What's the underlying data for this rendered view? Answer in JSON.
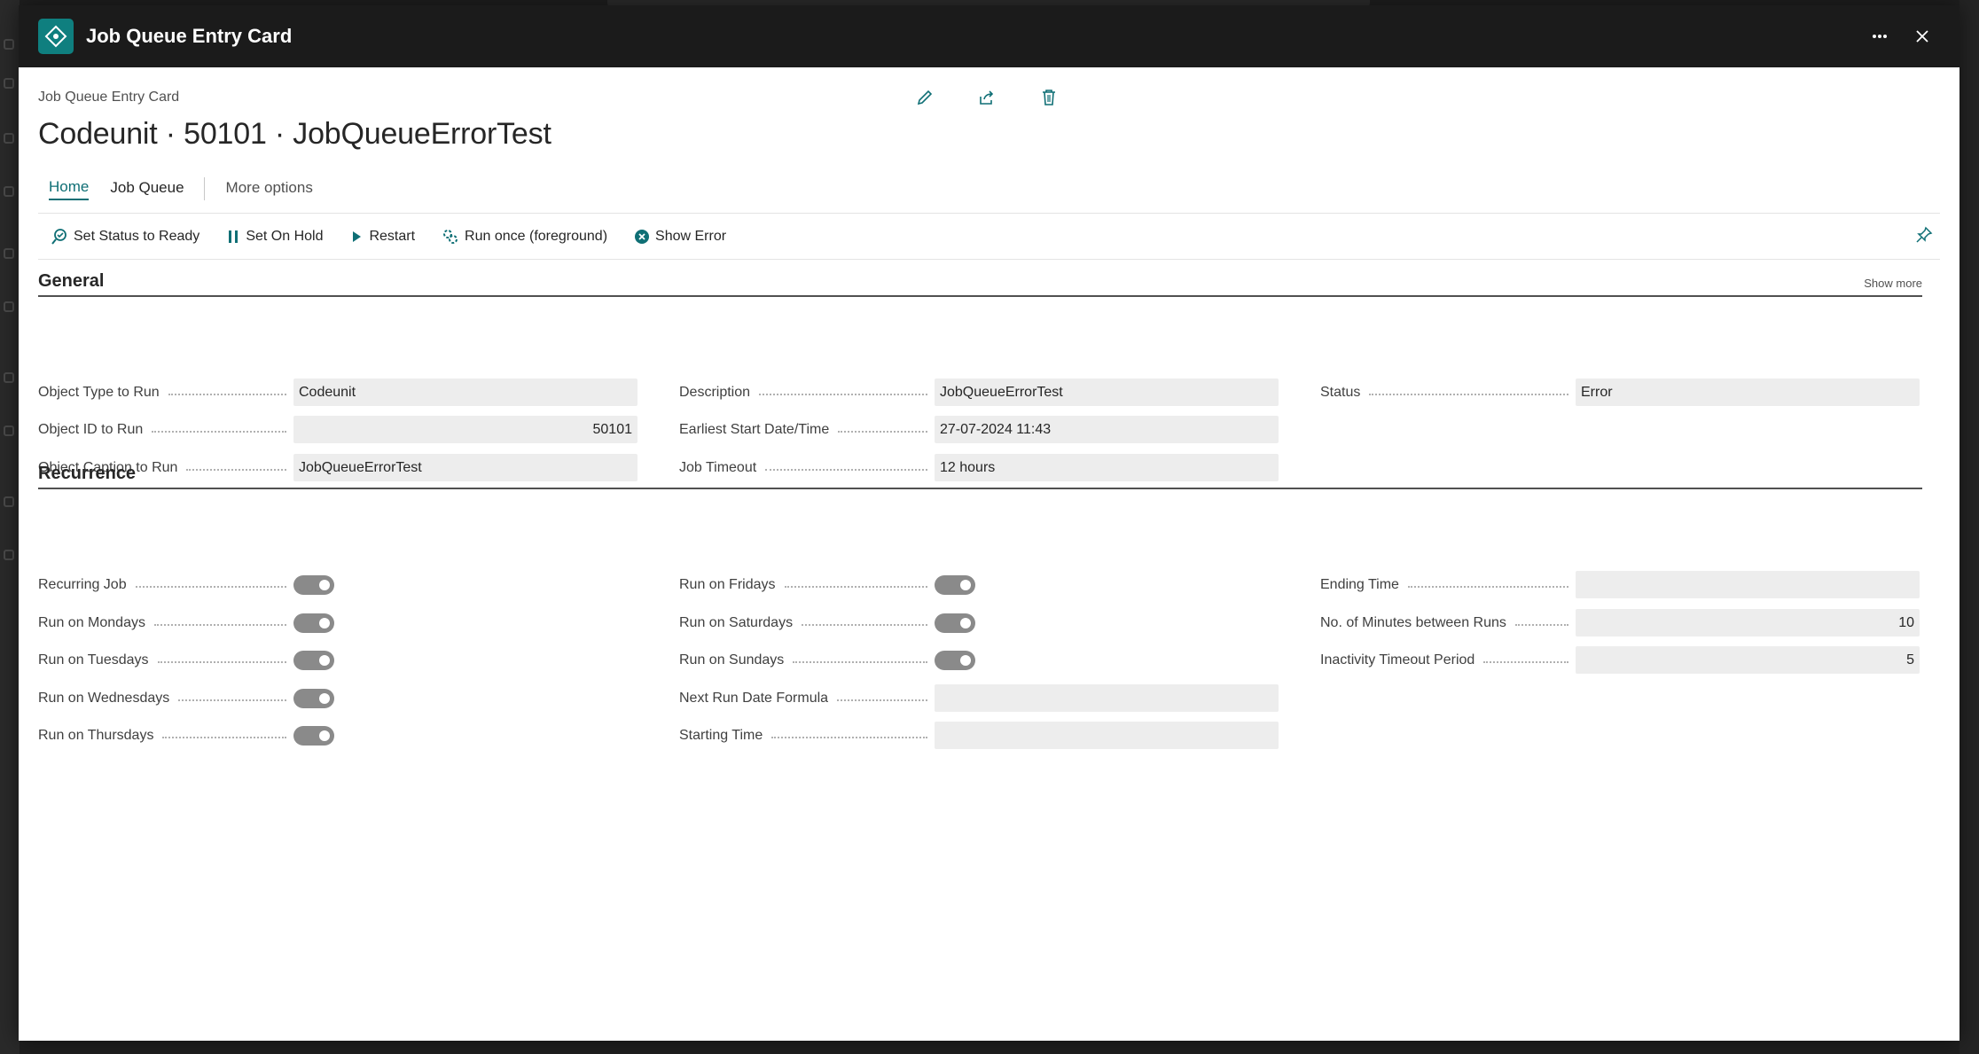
{
  "window": {
    "title": "Job Queue Entry Card"
  },
  "breadcrumb": "Job Queue Entry Card",
  "page_title": "Codeunit · 50101 · JobQueueErrorTest",
  "tabs": [
    {
      "label": "Home",
      "active": true
    },
    {
      "label": "Job Queue"
    },
    {
      "label": "More options"
    }
  ],
  "actions": [
    {
      "label": "Set Status to Ready",
      "icon": "status-ready-icon"
    },
    {
      "label": "Set On Hold",
      "icon": "pause-icon"
    },
    {
      "label": "Restart",
      "icon": "play-icon"
    },
    {
      "label": "Run once (foreground)",
      "icon": "run-once-icon"
    },
    {
      "label": "Show Error",
      "icon": "error-icon"
    }
  ],
  "general": {
    "title": "General",
    "show_more": "Show more",
    "object_type_label": "Object Type to Run",
    "object_type_value": "Codeunit",
    "object_id_label": "Object ID to Run",
    "object_id_value": "50101",
    "object_caption_label": "Object Caption to Run",
    "object_caption_value": "JobQueueErrorTest",
    "description_label": "Description",
    "description_value": "JobQueueErrorTest",
    "earliest_start_label": "Earliest Start Date/Time",
    "earliest_start_value": "27-07-2024 11:43",
    "job_timeout_label": "Job Timeout",
    "job_timeout_value": "12 hours",
    "status_label": "Status",
    "status_value": "Error"
  },
  "recurrence": {
    "title": "Recurrence",
    "recurring_job_label": "Recurring Job",
    "run_mondays_label": "Run on Mondays",
    "run_tuesdays_label": "Run on Tuesdays",
    "run_wednesdays_label": "Run on Wednesdays",
    "run_thursdays_label": "Run on Thursdays",
    "run_fridays_label": "Run on Fridays",
    "run_saturdays_label": "Run on Saturdays",
    "run_sundays_label": "Run on Sundays",
    "next_run_formula_label": "Next Run Date Formula",
    "next_run_formula_value": "",
    "starting_time_label": "Starting Time",
    "starting_time_value": "",
    "ending_time_label": "Ending Time",
    "ending_time_value": "",
    "minutes_between_label": "No. of Minutes between Runs",
    "minutes_between_value": "10",
    "inactivity_timeout_label": "Inactivity Timeout Period",
    "inactivity_timeout_value": "5"
  },
  "colors": {
    "accent": "#0f6f75",
    "titlebar": "#1b1b1b",
    "field_bg": "#ededed"
  }
}
